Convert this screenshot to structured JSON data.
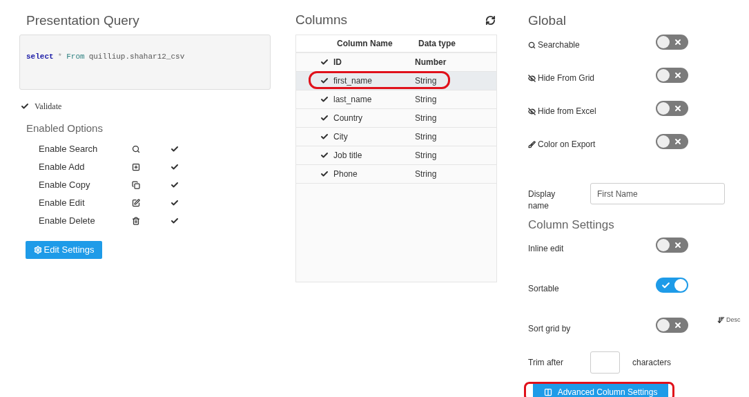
{
  "query_panel": {
    "title": "Presentation Query",
    "query_tokens": [
      {
        "text": "select",
        "kind": "keyword"
      },
      {
        "text": "*",
        "kind": "operator"
      },
      {
        "text": "From",
        "kind": "clause"
      },
      {
        "text": "quilliup.shahar12_csv",
        "kind": "identifier"
      }
    ],
    "validate": {
      "label": "Validate",
      "checked": true
    },
    "options_title": "Enabled Options",
    "options": [
      {
        "label": "Enable Search",
        "kind": "search",
        "checked": true
      },
      {
        "label": "Enable Add",
        "kind": "add",
        "checked": true
      },
      {
        "label": "Enable Copy",
        "kind": "copy",
        "checked": true
      },
      {
        "label": "Enable Edit",
        "kind": "edit",
        "checked": true
      },
      {
        "label": "Enable Delete",
        "kind": "delete",
        "checked": true
      }
    ],
    "edit_button": "Edit Settings"
  },
  "columns_panel": {
    "title": "Columns",
    "headers": [
      "Column Name",
      "Data type"
    ],
    "rows": [
      {
        "name": "ID",
        "type": "Number",
        "checked": true,
        "key": true,
        "selected": false,
        "circled": false
      },
      {
        "name": "first_name",
        "type": "String",
        "checked": true,
        "key": false,
        "selected": true,
        "circled": true
      },
      {
        "name": "last_name",
        "type": "String",
        "checked": true,
        "key": false,
        "selected": false,
        "circled": false
      },
      {
        "name": "Country",
        "type": "String",
        "checked": true,
        "key": false,
        "selected": false,
        "circled": false
      },
      {
        "name": "City",
        "type": "String",
        "checked": true,
        "key": false,
        "selected": false,
        "circled": false
      },
      {
        "name": "Job title",
        "type": "String",
        "checked": true,
        "key": false,
        "selected": false,
        "circled": false
      },
      {
        "name": "Phone",
        "type": "String",
        "checked": true,
        "key": false,
        "selected": false,
        "circled": false
      }
    ]
  },
  "global_panel": {
    "title": "Global",
    "toggles": [
      {
        "label": "Searchable",
        "kind": "search",
        "on": false
      },
      {
        "label": "Hide From Grid",
        "kind": "hidden",
        "on": false
      },
      {
        "label": "Hide from Excel",
        "kind": "hidden",
        "on": false
      },
      {
        "label": "Color on Export",
        "kind": "brush",
        "on": false
      }
    ],
    "display_name": {
      "label": "Display name",
      "value": "First Name"
    }
  },
  "column_settings": {
    "title": "Column Settings",
    "toggles": [
      {
        "label": "Inline edit",
        "on": false
      },
      {
        "label": "Sortable",
        "on": true
      },
      {
        "label": "Sort grid by",
        "on": false,
        "sort_order": "Desc"
      }
    ],
    "trim": {
      "label": "Trim after",
      "suffix": "characters"
    },
    "advanced_button": {
      "label": "Advanced Column Settings",
      "circled": true
    }
  }
}
